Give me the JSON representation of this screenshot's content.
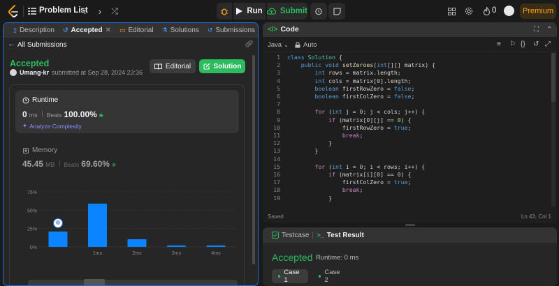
{
  "topbar": {
    "problem_list": "Problem List",
    "run": "Run",
    "submit": "Submit",
    "streak": "0",
    "premium": "Premium"
  },
  "left_tabs": {
    "description": "Description",
    "accepted": "Accepted",
    "editorial": "Editorial",
    "solutions": "Solutions",
    "submissions": "Submissions"
  },
  "submission": {
    "back": "All Submissions",
    "status": "Accepted",
    "author": "Umang-kr",
    "submitted": "submitted at Sep 28, 2024 23:36",
    "editorial_btn": "Editorial",
    "solution_btn": "Solution",
    "runtime_label": "Runtime",
    "runtime_value": "0",
    "runtime_unit": "ms",
    "beats_label": "Beats",
    "runtime_beats": "100.00%",
    "analyze": "Analyze Complexity",
    "memory_label": "Memory",
    "memory_value": "45.45",
    "memory_unit": "MB",
    "memory_beats": "69.60%"
  },
  "chart_data": {
    "type": "bar",
    "y_ticks": [
      "75%",
      "50%",
      "25%",
      "0%"
    ],
    "ylim": [
      0,
      75
    ],
    "x_tick_labels": [
      "1ms",
      "2ms",
      "3ms",
      "4ms"
    ],
    "bars": [
      {
        "x": "0ms",
        "value": 21,
        "highlighted": true
      },
      {
        "x": "1ms",
        "value": 59
      },
      {
        "x": "2ms",
        "value": 10.5
      },
      {
        "x": "3ms",
        "value": 2
      },
      {
        "x": "4ms",
        "value": 2
      }
    ],
    "colors": {
      "bar": "#0a84ff",
      "grid": "#3a3a3a"
    }
  },
  "code": {
    "title": "Code",
    "language": "Java",
    "mode": "Auto",
    "status": "Saved",
    "cursor": "Ln 43, Col 1",
    "lines": [
      "class Solution {",
      "    public void setZeroes(int[][] matrix) {",
      "        int rows = matrix.length;",
      "        int cols = matrix[0].length;",
      "        boolean firstRowZero = false;",
      "        boolean firstColZero = false;",
      "",
      "        for (int j = 0; j < cols; j++) {",
      "            if (matrix[0][j] == 0) {",
      "                firstRowZero = true;",
      "                break;",
      "            }",
      "        }",
      "",
      "        for (int i = 0; i < rows; i++) {",
      "            if (matrix[i][0] == 0) {",
      "                firstColZero = true;",
      "                break;",
      "            }"
    ]
  },
  "result": {
    "testcase_tab": "Testcase",
    "result_tab": "Test Result",
    "status": "Accepted",
    "runtime": "Runtime: 0 ms",
    "cases": [
      "Case 1",
      "Case 2"
    ]
  }
}
